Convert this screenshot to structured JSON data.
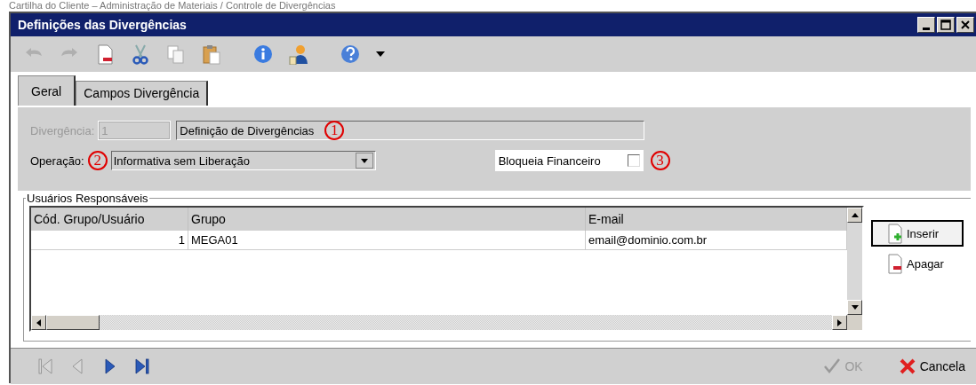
{
  "caption": "Cartilha do Cliente – Administração de Materiais / Controle de Divergências",
  "window": {
    "title": "Definições das Divergências"
  },
  "toolbar": [
    {
      "kind": "undo",
      "disabled": true
    },
    {
      "kind": "redo",
      "disabled": true
    },
    {
      "kind": "new",
      "disabled": false
    },
    {
      "kind": "cut",
      "disabled": false
    },
    {
      "kind": "copy",
      "disabled": false
    },
    {
      "kind": "paste",
      "disabled": false
    },
    {
      "kind": "info",
      "disabled": false
    },
    {
      "kind": "user",
      "disabled": false
    },
    {
      "kind": "help",
      "disabled": false
    },
    {
      "kind": "dropdown",
      "disabled": false
    }
  ],
  "tabs": [
    {
      "label": "Geral",
      "selected": true
    },
    {
      "label": "Campos Divergência",
      "selected": false
    }
  ],
  "form": {
    "divergencia": {
      "label": "Divergência:",
      "value": "1",
      "disabled": true
    },
    "description": {
      "value": "Definição de Divergências",
      "annotation": "1"
    },
    "operacao": {
      "label": "Operação:",
      "value": "Informativa sem Liberação",
      "annotation": "2"
    },
    "bloqueia": {
      "label": "Bloqueia Financeiro",
      "checked": false,
      "annotation": "3"
    }
  },
  "group": {
    "title": "Usuários Responsáveis",
    "columns": [
      "Cód. Grupo/Usuário",
      "Grupo",
      "E-mail"
    ],
    "rows": [
      [
        "1",
        "MEGA01",
        "email@dominio.com.br"
      ]
    ]
  },
  "side_buttons": [
    {
      "label": "Inserir",
      "kind": "add",
      "focused": true
    },
    {
      "label": "Apagar",
      "kind": "delete",
      "focused": false
    }
  ],
  "navigation": [
    {
      "kind": "first",
      "disabled": true
    },
    {
      "kind": "prev",
      "disabled": true
    },
    {
      "kind": "next",
      "disabled": false
    },
    {
      "kind": "last",
      "disabled": false
    }
  ],
  "footer_buttons": [
    {
      "label": "OK",
      "kind": "ok",
      "disabled": true
    },
    {
      "label": "Cancela",
      "kind": "cancel",
      "disabled": false
    }
  ]
}
